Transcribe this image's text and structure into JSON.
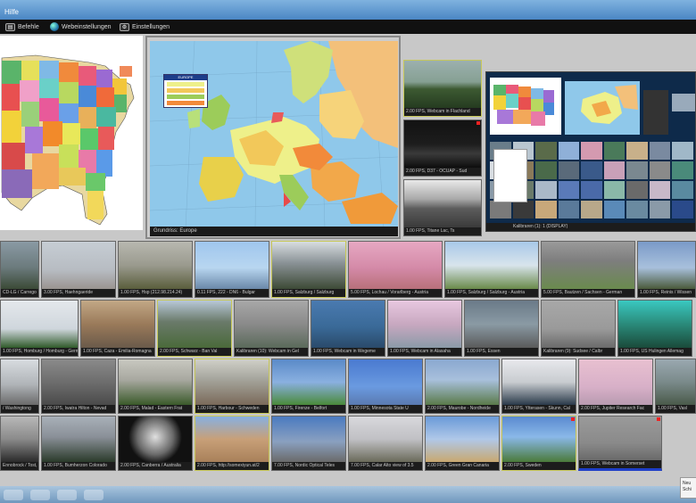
{
  "window": {
    "title": "Hilfe"
  },
  "menu": [
    {
      "label": "Befehle",
      "icon": "command-icon"
    },
    {
      "label": "Webeinstellungen",
      "icon": "globe-icon"
    },
    {
      "label": "Einstellungen",
      "icon": "settings-icon"
    }
  ],
  "europe_map": {
    "caption": "Grundriss: Europe",
    "legend_title": "EUROPE"
  },
  "side_thumbs": [
    {
      "caption": "2.00 FPS, Webcam in Flachland"
    },
    {
      "caption": "2.00 FPS, D37 - OCUAP - Sud"
    },
    {
      "caption": "1.00 FPS, Titane Lac, Ts"
    }
  ],
  "display_screen": {
    "caption": "Kalibraren (1): 1 (DISPLAY)"
  },
  "grid_rows": [
    [
      "CD-LG / Carrego",
      "3.00 FPS, Haehngaeride",
      "1.00 FPS, Hsp (212.98.214.24)",
      "0.11 FPS, 222 - DN6 - Bulgar",
      "1.00 FPS, Salzburg / Salzburg",
      "5.00 FPS, Lochau / Vorarlberg - Austria",
      "1.00 FPS, Salzburg / Salzburg - Austria",
      "5.00 FPS, Bautzen / Sachsen - German",
      "1.00 FPS, Reinis / Wissen"
    ],
    [
      "1.00 FPS, Homburg / Homburg - German",
      "1.00 FPS, Caza - Emilia-Romagna",
      "2.00 FPS, Schwarz - Ban Val",
      "Kalibraren (10): Webcam in Gel",
      "1.00 FPS, Webcam in Wegeme",
      "1.00 FPS, Webcam in Alasaha",
      "1.00 FPS, Essen",
      "Kalibraren (9): Sudsee / Calbr",
      "1.00 FPS, US Hulingen Allemag"
    ],
    [
      "/ Washingtong",
      "2.00 FPS, Iwatra Hilton - Nevad",
      "2.00 FPS, Malad - Eastern Frat",
      "1.00 FPS, Harbour - Schweden",
      "1.00 FPS, Firenze - Belfort",
      "1.00 FPS, Minnesota State U",
      "2.00 FPS, Maurobe - Nordheide",
      "1.00 FPS, Ytterasen - Skunn, Cal",
      "2.00 FPS, Jupiter Research Fac",
      "1.00 FPS, Vasl"
    ],
    [
      "Ennobrock / Tost, Rus",
      "1.00 FPS, Bumherzon Colorado",
      "2.00 FPS, Canberra / Australia",
      "2.00 FPS, http://somexiyun.at/2",
      "7.00 FPS, Nordic Optical Teles",
      "7.00 FPS, Calar Alto view of 3.5",
      "2.00 FPS, Green Gran Canaria",
      "2.00 FPS, Sweden",
      "1.00 FPS, Webcam in Somerset"
    ]
  ],
  "notification": {
    "text": "Neu Schi"
  }
}
